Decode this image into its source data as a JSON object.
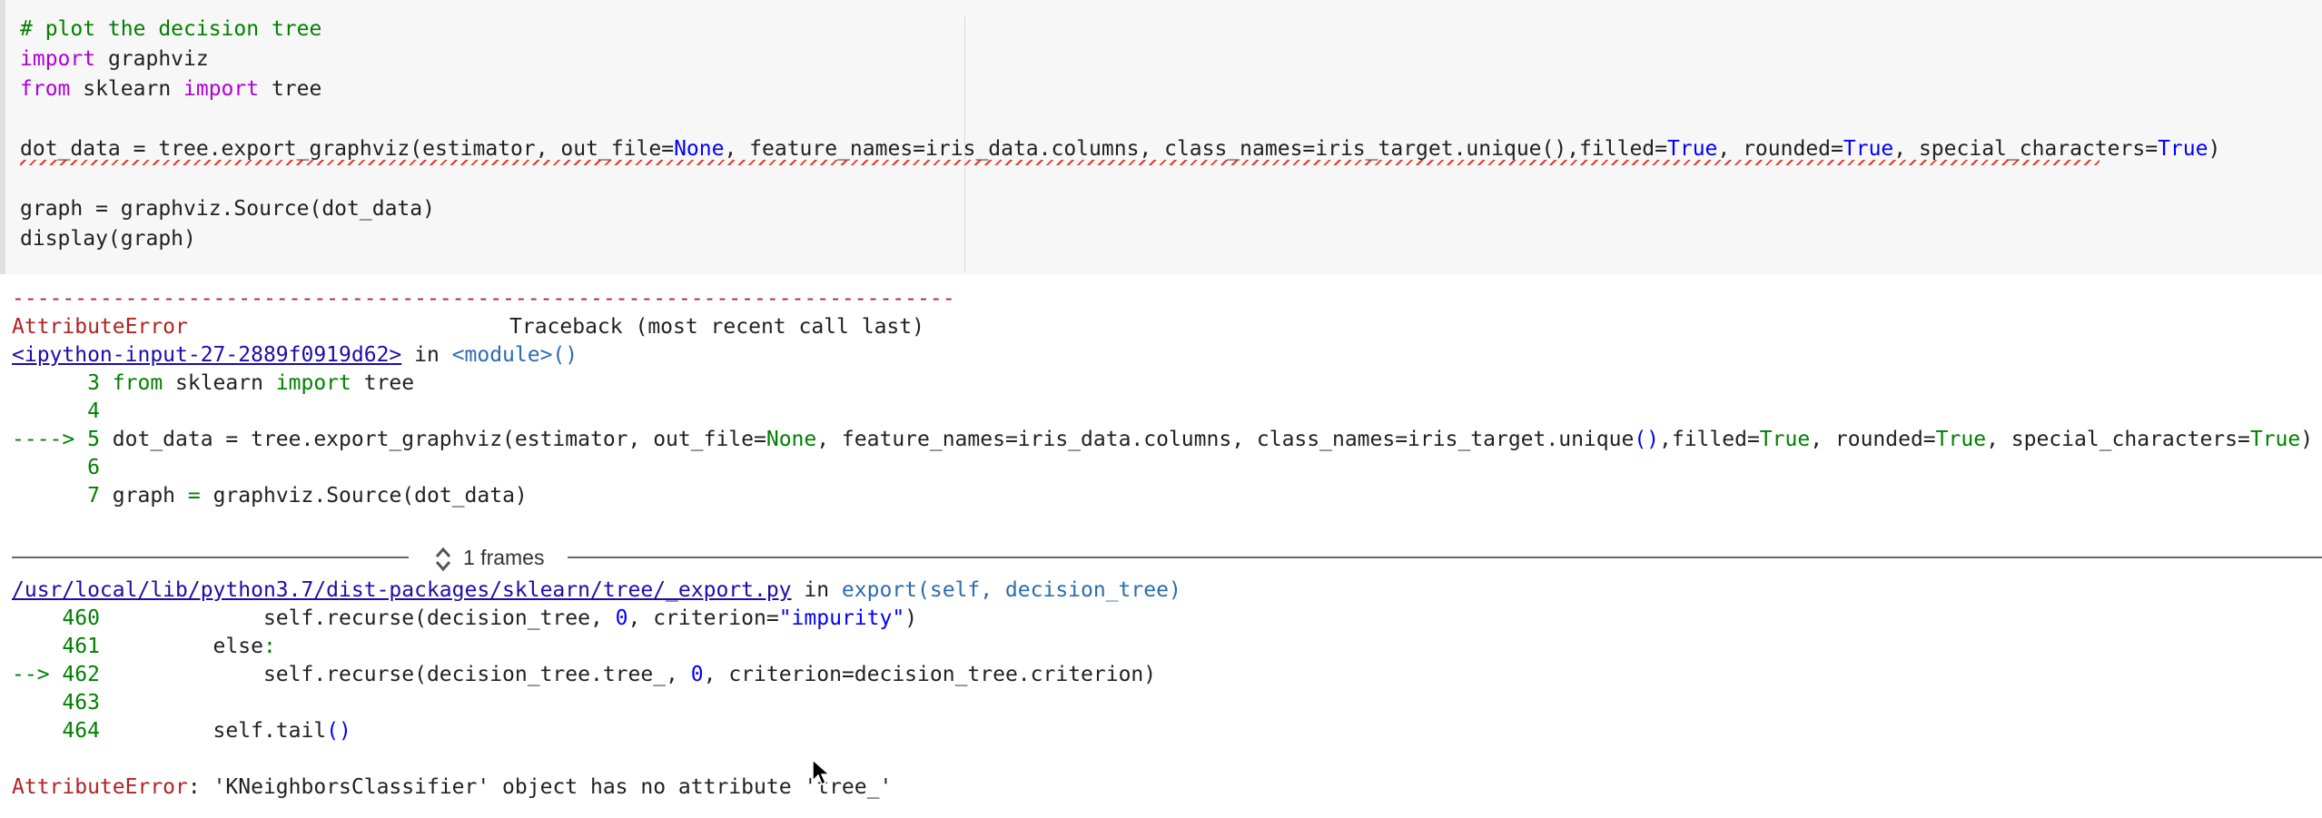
{
  "code_cell": {
    "lines": [
      {
        "parts": [
          [
            "# plot the decision tree",
            "cm"
          ]
        ]
      },
      {
        "parts": [
          [
            "import",
            "kw"
          ],
          [
            " graphviz",
            ""
          ]
        ]
      },
      {
        "parts": [
          [
            "from",
            "kw"
          ],
          [
            " sklearn ",
            ""
          ],
          [
            "import",
            "kw"
          ],
          [
            " tree",
            ""
          ]
        ]
      },
      {
        "parts": [
          [
            "",
            ""
          ]
        ]
      },
      {
        "parts": [
          [
            "dot_data = tree.export_graphviz(estimator, out_file=",
            ""
          ],
          [
            "None",
            "bl"
          ],
          [
            ", feature_names=iris_data.columns, class_names=iris_target.unique(),filled=",
            ""
          ],
          [
            "True",
            "bl"
          ],
          [
            ", rounded=",
            ""
          ],
          [
            "True",
            "bl"
          ],
          [
            ", special_characters=",
            ""
          ],
          [
            "True",
            "bl"
          ],
          [
            ")",
            ""
          ]
        ]
      },
      {
        "parts": [
          [
            "",
            ""
          ]
        ]
      },
      {
        "parts": [
          [
            "graph = graphviz.Source(dot_data)",
            ""
          ]
        ]
      },
      {
        "parts": [
          [
            "display(graph)",
            ""
          ]
        ]
      }
    ]
  },
  "output": {
    "separator": "---------------------------------------------------------------------------",
    "error_name": "AttributeError",
    "traceback_header": "Traceback (most recent call last)",
    "input_link": "<ipython-input-27-2889f0919d62>",
    "in_text": " in ",
    "module": "<module>()",
    "context1": [
      {
        "num": "      3 ",
        "parts": [
          [
            "from",
            "green"
          ],
          [
            " sklearn ",
            ""
          ],
          [
            "import",
            "green"
          ],
          [
            " tree",
            ""
          ]
        ]
      },
      {
        "num": "      4 ",
        "parts": []
      },
      {
        "num": "----> 5 ",
        "parts": [
          [
            "dot_data = tree.export_graphviz(estimator, out_file=",
            ""
          ],
          [
            "None",
            "green"
          ],
          [
            ", feature_names=iris_data.columns, class_names=iris_target.unique",
            ""
          ],
          [
            "()",
            "bl"
          ],
          [
            ",filled=",
            ""
          ],
          [
            "True",
            "green"
          ],
          [
            ", rounded=",
            ""
          ],
          [
            "True",
            "green"
          ],
          [
            ", special_characters=",
            ""
          ],
          [
            "True",
            "green"
          ],
          [
            ")",
            ""
          ]
        ]
      },
      {
        "num": "      6 ",
        "parts": []
      },
      {
        "num": "      7 ",
        "parts": [
          [
            "graph ",
            ""
          ],
          [
            "=",
            "green"
          ],
          [
            " graphviz.Source(dot_data)",
            ""
          ]
        ]
      }
    ],
    "frames_label": "1 frames",
    "file_link": "/usr/local/lib/python3.7/dist-packages/sklearn/tree/_export.py",
    "file_in": " in ",
    "file_func": "export(self, decision_tree)",
    "context2": [
      {
        "num": "    460 ",
        "parts": [
          [
            "            self.recurse(decision_tree, ",
            ""
          ],
          [
            "0",
            "bl"
          ],
          [
            ", criterion=",
            ""
          ],
          [
            "\"impurity\"",
            "bl"
          ],
          [
            ")",
            ""
          ]
        ]
      },
      {
        "num": "    461 ",
        "parts": [
          [
            "        else",
            ""
          ],
          [
            ":",
            "green"
          ]
        ]
      },
      {
        "num": "--> 462 ",
        "parts": [
          [
            "            self.recurse(decision_tree.tree_, ",
            ""
          ],
          [
            "0",
            "bl"
          ],
          [
            ", criterion=decision_tree.criterion)",
            ""
          ]
        ]
      },
      {
        "num": "    463 ",
        "parts": []
      },
      {
        "num": "    464 ",
        "parts": [
          [
            "        self.tail",
            ""
          ],
          [
            "()",
            "bl"
          ]
        ]
      }
    ],
    "final_error_name": "AttributeError",
    "final_error_msg": ": 'KNeighborsClassifier' object has no attribute 'tree_'"
  },
  "colors": {
    "keyword": "#af00db",
    "comment": "#008000",
    "builtin": "#0000ff",
    "error": "#b22222",
    "link": "#1a0dab"
  }
}
